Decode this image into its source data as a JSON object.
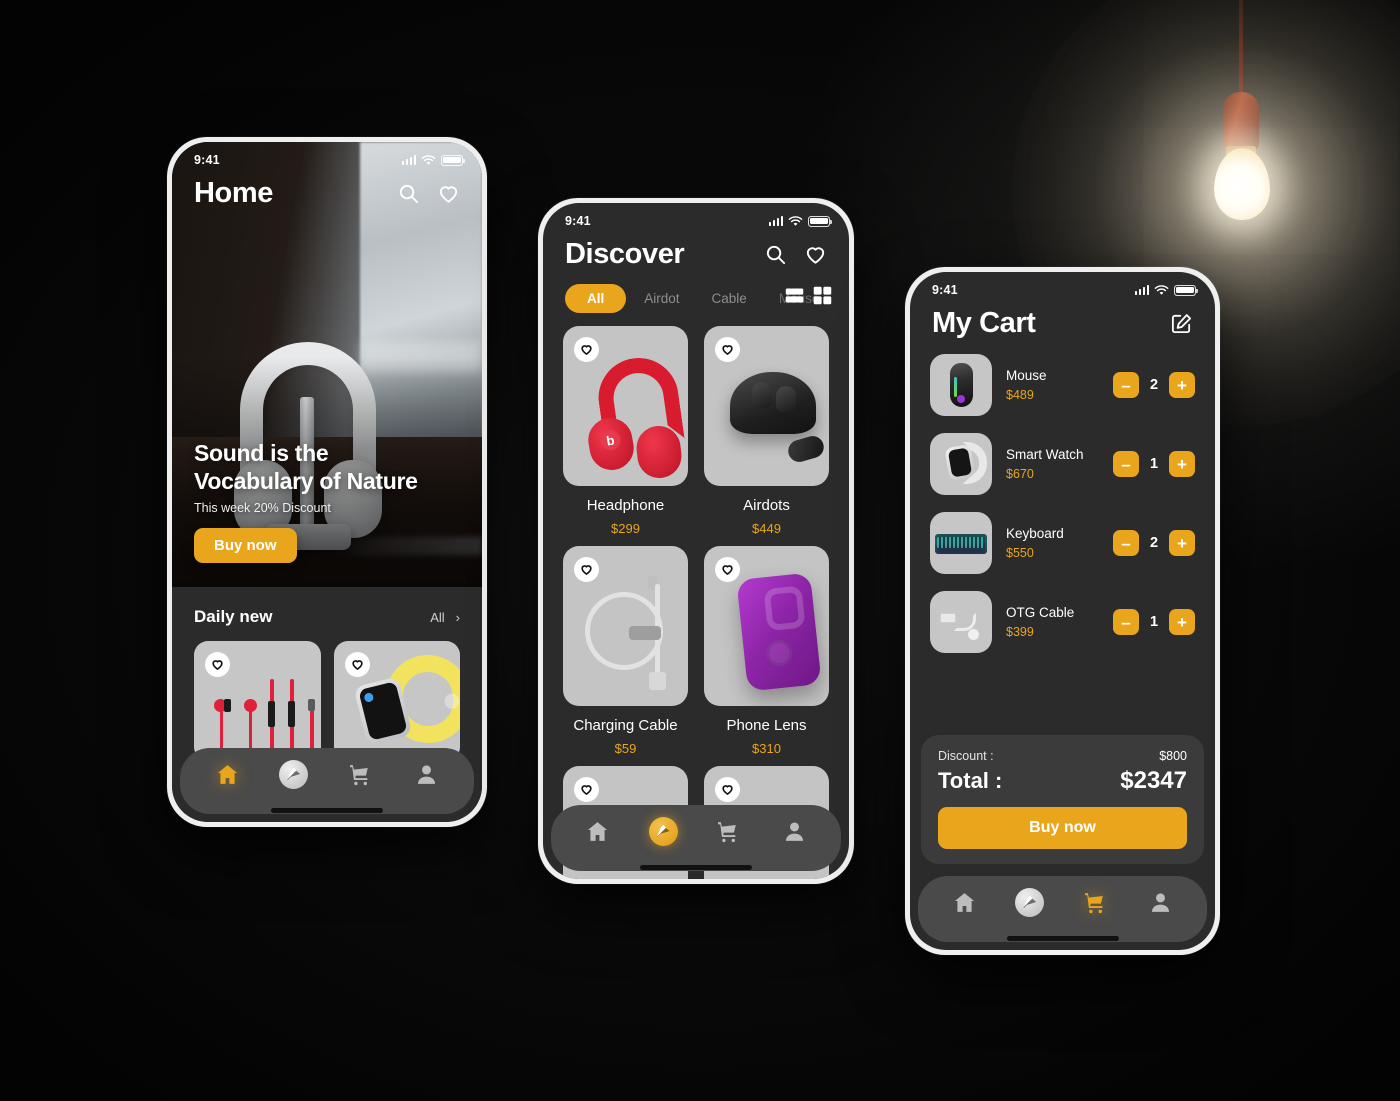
{
  "scene": {
    "background_color": "#050505",
    "accent_color": "#e9a61d",
    "lamp": {
      "name": "pendant-light-bulb",
      "glow_color": "#fff8e2"
    }
  },
  "status_bar": {
    "time": "9:41",
    "signal": "signal-bars",
    "wifi": "wifi",
    "battery": "battery-full"
  },
  "home": {
    "title": "Home",
    "icons": {
      "search": "search-icon",
      "favorite": "heart-icon"
    },
    "hero": {
      "headline_line1": "Sound is the",
      "headline_line2": "Vocabulary of Nature",
      "subtitle": "This week 20% Discount",
      "cta": "Buy now"
    },
    "daily": {
      "section_title": "Daily new",
      "see_all": "All",
      "chevron": "›",
      "cards": [
        {
          "name": "earphones-card",
          "fav": "heart-icon"
        },
        {
          "name": "smart-watch-card",
          "fav": "heart-icon"
        }
      ]
    },
    "nav": [
      {
        "id": "home",
        "icon": "home-icon",
        "active": true
      },
      {
        "id": "discover",
        "icon": "compass-icon",
        "active": false
      },
      {
        "id": "cart",
        "icon": "cart-icon",
        "active": false
      },
      {
        "id": "profile",
        "icon": "person-icon",
        "active": false
      }
    ]
  },
  "discover": {
    "title": "Discover",
    "icons": {
      "search": "search-icon",
      "favorite": "heart-icon"
    },
    "tabs": [
      {
        "label": "All",
        "active": true
      },
      {
        "label": "Airdot",
        "active": false
      },
      {
        "label": "Cable",
        "active": false
      },
      {
        "label": "Mouse",
        "active": false,
        "faded": true
      }
    ],
    "view_toggles": [
      {
        "name": "list-view-icon",
        "active": false
      },
      {
        "name": "grid-view-icon",
        "active": true
      }
    ],
    "products": [
      {
        "name": "Headphone",
        "price": "$299",
        "art": "red-headphone",
        "fav": "heart-icon"
      },
      {
        "name": "Airdots",
        "price": "$449",
        "art": "black-airdots",
        "fav": "heart-icon"
      },
      {
        "name": "Charging Cable",
        "price": "$59",
        "art": "white-cable",
        "fav": "heart-icon"
      },
      {
        "name": "Phone Lens",
        "price": "$310",
        "art": "purple-phone-case",
        "fav": "heart-icon"
      }
    ],
    "nav": [
      {
        "id": "home",
        "icon": "home-icon",
        "active": false
      },
      {
        "id": "discover",
        "icon": "compass-icon",
        "active": true
      },
      {
        "id": "cart",
        "icon": "cart-icon",
        "active": false
      },
      {
        "id": "profile",
        "icon": "person-icon",
        "active": false
      }
    ]
  },
  "cart": {
    "title": "My Cart",
    "edit_icon": "edit-pencil-icon",
    "items": [
      {
        "name": "Mouse",
        "price": "$489",
        "qty": "2",
        "art": "gaming-mouse",
        "minus": "–",
        "plus": "+"
      },
      {
        "name": "Smart Watch",
        "price": "$670",
        "qty": "1",
        "art": "smart-watch",
        "minus": "–",
        "plus": "+"
      },
      {
        "name": "Keyboard",
        "price": "$550",
        "qty": "2",
        "art": "rgb-keyboard",
        "minus": "–",
        "plus": "+"
      },
      {
        "name": "OTG Cable",
        "price": "$399",
        "qty": "1",
        "art": "otg-cable",
        "minus": "–",
        "plus": "+"
      }
    ],
    "summary": {
      "discount_label": "Discount :",
      "discount_value": "$800",
      "total_label": "Total :",
      "total_value": "$2347",
      "cta": "Buy now"
    },
    "nav": [
      {
        "id": "home",
        "icon": "home-icon",
        "active": false
      },
      {
        "id": "discover",
        "icon": "compass-icon",
        "active": false
      },
      {
        "id": "cart",
        "icon": "cart-icon",
        "active": true
      },
      {
        "id": "profile",
        "icon": "person-icon",
        "active": false
      }
    ]
  }
}
